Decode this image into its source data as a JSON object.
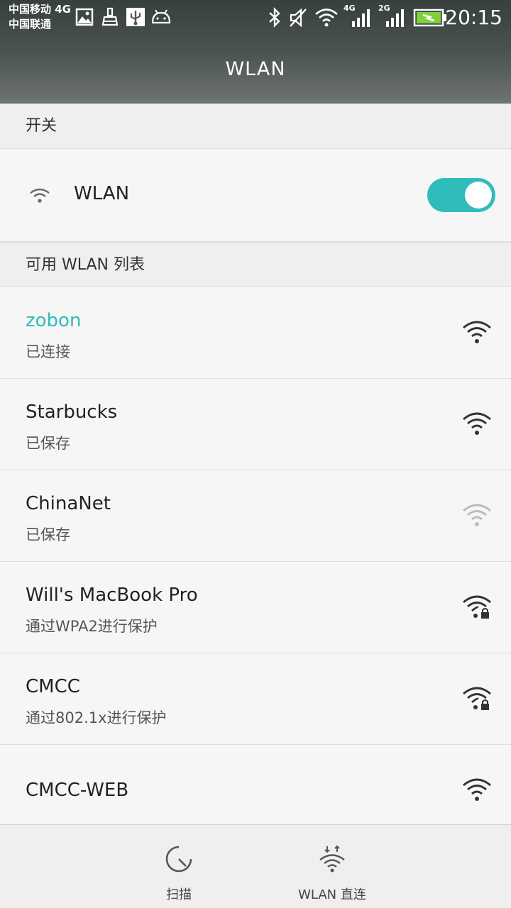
{
  "status_bar": {
    "carrier_1": "中国移动 4G",
    "carrier_2": "中国联通",
    "net_4g": "4G",
    "net_2g": "2G",
    "time": "20:15",
    "icons": [
      "image-icon",
      "cleaner-icon",
      "usb-icon",
      "android-icon",
      "bluetooth-icon",
      "mute-icon",
      "wifi-icon",
      "signal-4g-icon",
      "signal-2g-icon",
      "battery-charging-icon"
    ]
  },
  "header": {
    "title": "WLAN"
  },
  "switch_section": {
    "header": "开关",
    "wlan_label": "WLAN",
    "wlan_enabled": true
  },
  "networks_section": {
    "header": "可用 WLAN 列表",
    "networks": [
      {
        "name": "zobon",
        "status": "已连接",
        "icon": "wifi-strong-icon",
        "connected": true
      },
      {
        "name": "Starbucks",
        "status": "已保存",
        "icon": "wifi-strong-icon"
      },
      {
        "name": "ChinaNet",
        "status": "已保存",
        "icon": "wifi-weak-icon"
      },
      {
        "name": "Will's MacBook Pro",
        "status": "通过WPA2进行保护",
        "icon": "wifi-locked-icon"
      },
      {
        "name": "CMCC",
        "status": "通过802.1x进行保护",
        "icon": "wifi-locked-icon"
      },
      {
        "name": "CMCC-WEB",
        "status": "",
        "icon": "wifi-strong-icon"
      }
    ]
  },
  "bottom_bar": {
    "scan_label": "扫描",
    "direct_label": "WLAN 直连"
  },
  "colors": {
    "accent": "#2fbdbb",
    "header_bg": "#4b5350",
    "background": "#f6f6f6"
  }
}
